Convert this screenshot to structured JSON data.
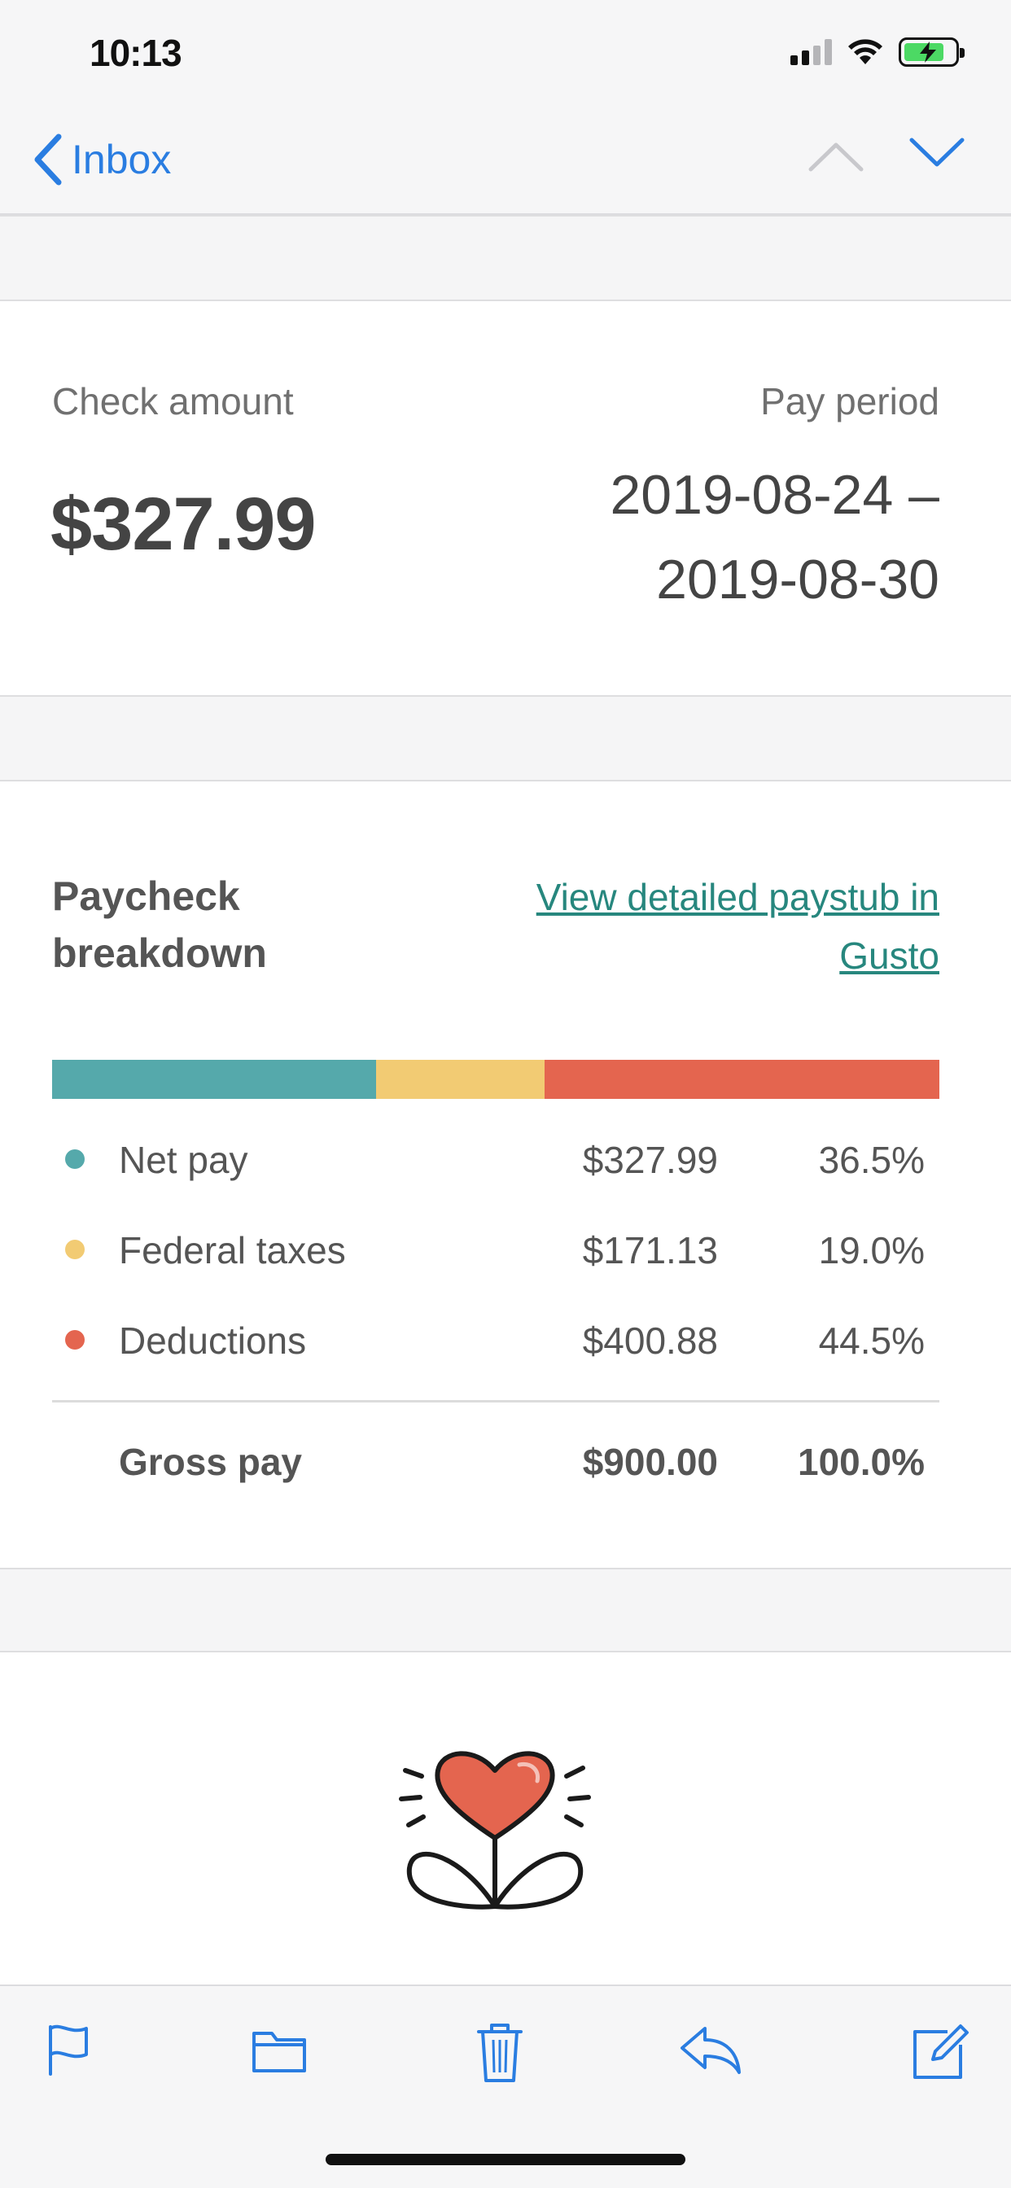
{
  "status_bar": {
    "time": "10:13",
    "icons": [
      "signal-icon",
      "wifi-icon",
      "battery-charging-icon"
    ]
  },
  "nav": {
    "back_label": "Inbox",
    "icons": [
      "chevron-left-icon",
      "chevron-up-icon",
      "chevron-down-icon"
    ],
    "accent_color": "#2A7DE1"
  },
  "summary": {
    "check_amount_label": "Check amount",
    "check_amount": "$327.99",
    "pay_period_label": "Pay period",
    "pay_period_start": "2019-08-24 –",
    "pay_period_end": "2019-08-30"
  },
  "breakdown": {
    "title": "Paycheck breakdown",
    "link_text": "View detailed paystub in Gusto",
    "rows": [
      {
        "label": "Net pay",
        "amount": "$327.99",
        "percent": "36.5%",
        "share": 0.365,
        "color": "#55A9AB"
      },
      {
        "label": "Federal taxes",
        "amount": "$171.13",
        "percent": "19.0%",
        "share": 0.19,
        "color": "#F2CB73"
      },
      {
        "label": "Deductions",
        "amount": "$400.88",
        "percent": "44.5%",
        "share": 0.445,
        "color": "#E4654F"
      }
    ],
    "total": {
      "label": "Gross pay",
      "amount": "$900.00",
      "percent": "100.0%"
    }
  },
  "illustration": {
    "icon": "heart-flower-icon",
    "color": "#E4654F"
  },
  "toolbar": {
    "icons": [
      "flag-icon",
      "folder-icon",
      "trash-icon",
      "reply-icon",
      "compose-icon"
    ]
  }
}
